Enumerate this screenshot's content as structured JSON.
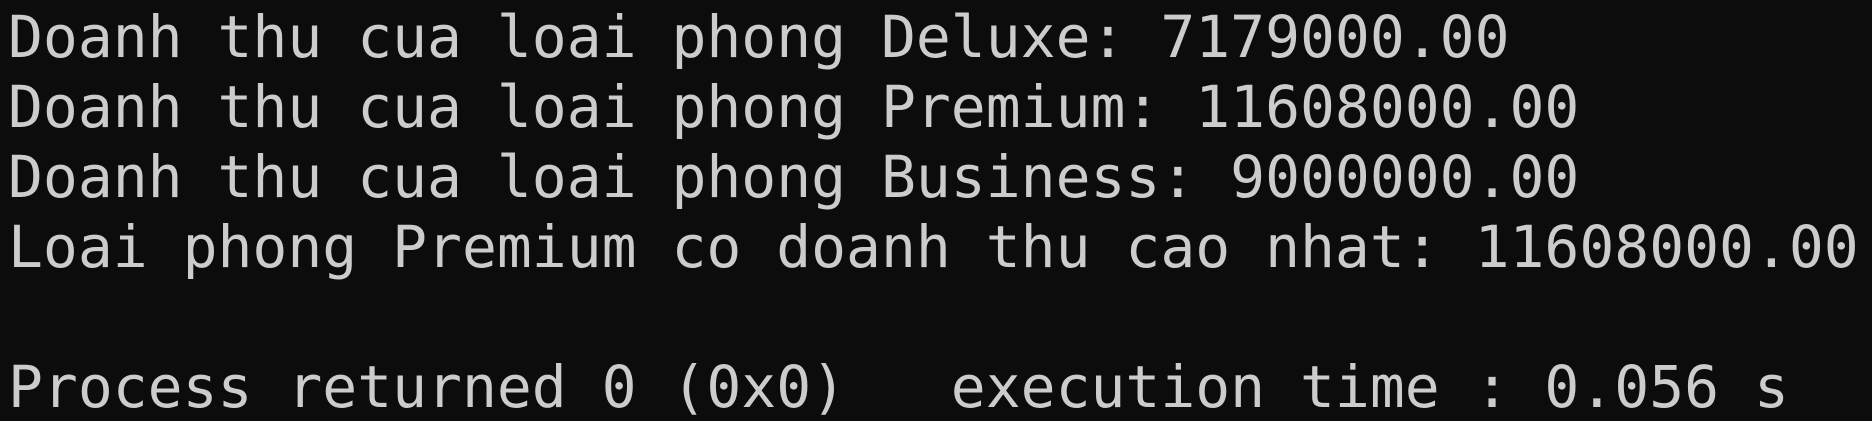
{
  "console": {
    "background": "#0c0c0c",
    "text_color": "#cccccc",
    "lines": [
      "Doanh thu cua loai phong Deluxe: 7179000.00",
      "Doanh thu cua loai phong Premium: 11608000.00",
      "Doanh thu cua loai phong Business: 9000000.00",
      "Loai phong Premium co doanh thu cao nhat: 11608000.00",
      "",
      "Process returned 0 (0x0)   execution time : 0.056 s"
    ]
  }
}
